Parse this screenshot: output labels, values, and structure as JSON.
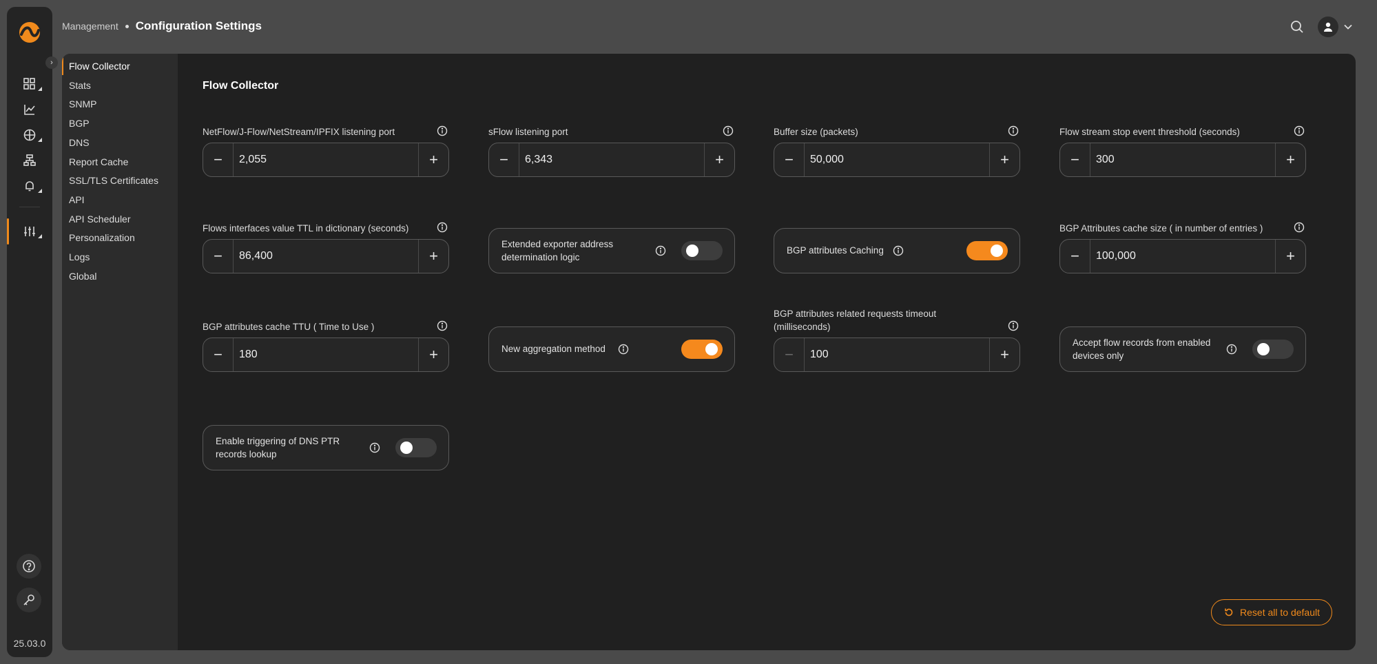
{
  "app": {
    "version": "25.03.0"
  },
  "breadcrumb": {
    "parent": "Management",
    "current": "Configuration Settings"
  },
  "subnav": {
    "items": [
      {
        "label": "Flow Collector",
        "active": true
      },
      {
        "label": "Stats"
      },
      {
        "label": "SNMP"
      },
      {
        "label": "BGP"
      },
      {
        "label": "DNS"
      },
      {
        "label": "Report Cache"
      },
      {
        "label": "SSL/TLS Certificates"
      },
      {
        "label": "API"
      },
      {
        "label": "API Scheduler"
      },
      {
        "label": "Personalization"
      },
      {
        "label": "Logs"
      },
      {
        "label": "Global"
      }
    ]
  },
  "section": {
    "title": "Flow Collector"
  },
  "fields": {
    "netflow_port": {
      "label": "NetFlow/J-Flow/NetStream/IPFIX listening port",
      "value": "2,055"
    },
    "sflow_port": {
      "label": "sFlow listening port",
      "value": "6,343"
    },
    "buffer_size": {
      "label": "Buffer size (packets)",
      "value": "50,000"
    },
    "stop_threshold": {
      "label": "Flow stream stop event threshold (seconds)",
      "value": "300"
    },
    "flows_ttl": {
      "label": "Flows interfaces value TTL in dictionary (seconds)",
      "value": "86,400"
    },
    "extended_exporter": {
      "label_line1": "Extended exporter address",
      "label_line2": "determination logic",
      "enabled": false
    },
    "bgp_caching": {
      "label": "BGP attributes Caching",
      "enabled": true
    },
    "bgp_cache_size": {
      "label": "BGP Attributes cache size ( in number of entries )",
      "value": "100,000"
    },
    "bgp_ttu": {
      "label": "BGP attributes cache TTU ( Time to Use )",
      "value": "180"
    },
    "new_aggregation": {
      "label": "New aggregation method",
      "enabled": true
    },
    "bgp_timeout": {
      "label_line1": "BGP attributes related requests timeout",
      "label_line2": "(milliseconds)",
      "value": "100"
    },
    "accept_enabled": {
      "label_line1": "Accept flow records from enabled",
      "label_line2": "devices only",
      "enabled": false
    },
    "dns_ptr": {
      "label_line1": "Enable triggering of DNS PTR",
      "label_line2": "records lookup",
      "enabled": false
    }
  },
  "actions": {
    "reset_label": "Reset all to default"
  },
  "colors": {
    "accent": "#f08a1c",
    "panel": "#202020",
    "background": "#4a4a4a"
  }
}
